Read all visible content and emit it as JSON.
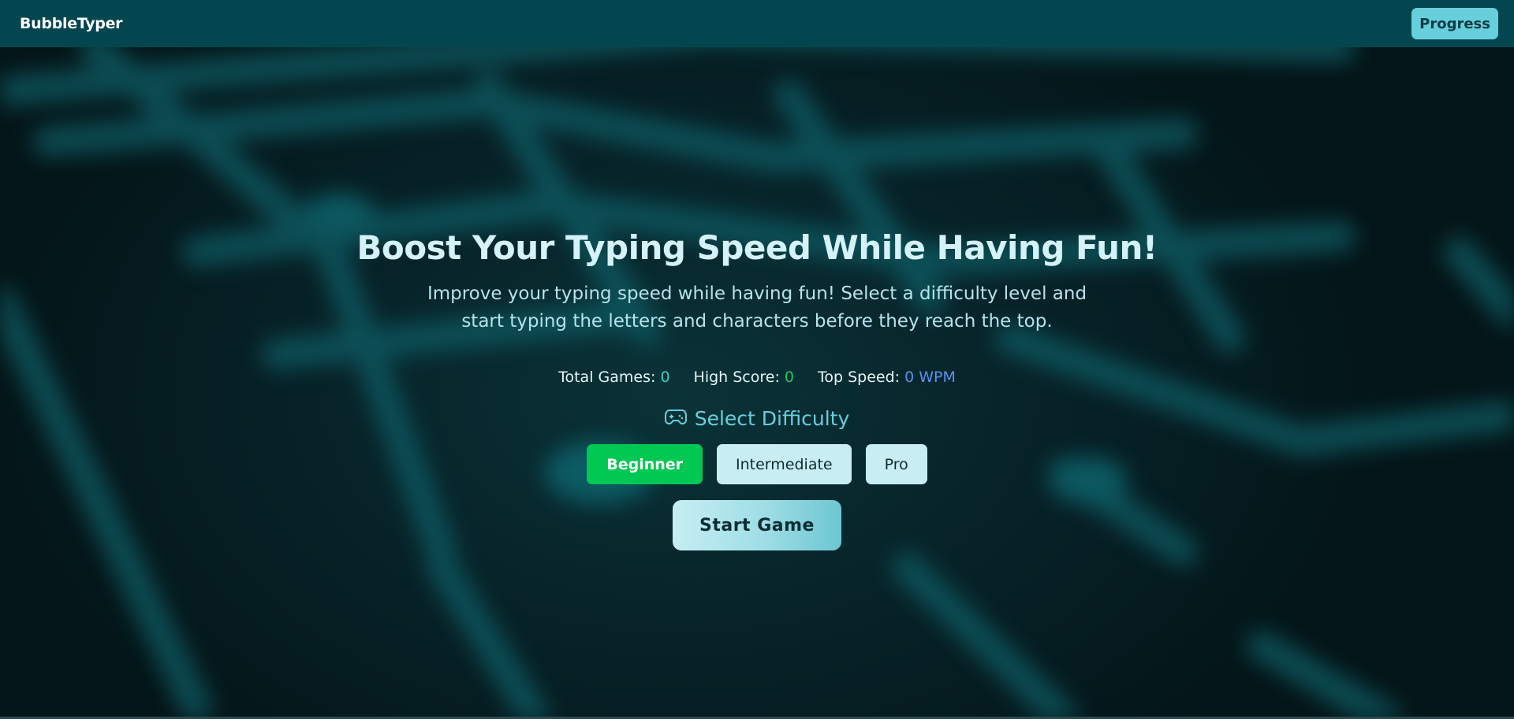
{
  "navbar": {
    "brand": "BubbleTyper",
    "progress_label": "Progress"
  },
  "hero": {
    "title": "Boost Your Typing Speed While Having Fun!",
    "subtitle": "Improve your typing speed while having fun! Select a difficulty level and start typing the letters and characters before they reach the top."
  },
  "stats": {
    "total_games_label": "Total Games:",
    "total_games_value": "0",
    "high_score_label": "High Score:",
    "high_score_value": "0",
    "top_speed_label": "Top Speed:",
    "top_speed_value": "0 WPM"
  },
  "difficulty": {
    "icon": "gamepad-icon",
    "heading": "Select Difficulty",
    "options": [
      "Beginner",
      "Intermediate",
      "Pro"
    ],
    "selected": "Beginner"
  },
  "start_label": "Start Game",
  "colors": {
    "navbar_bg": "#044650",
    "accent": "#67cfdc",
    "active_green": "#00c853",
    "stat_blue": "#5b8ff0"
  }
}
